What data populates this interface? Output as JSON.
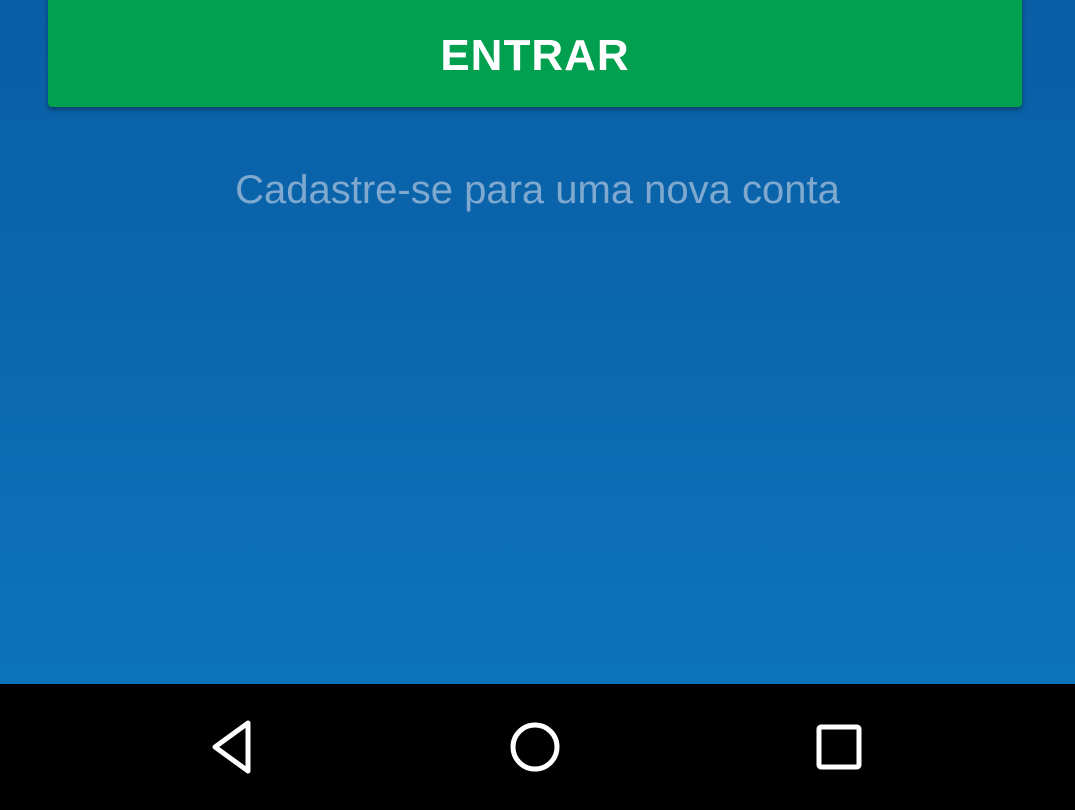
{
  "login": {
    "button_label": "ENTRAR",
    "button_color": "#00a04f"
  },
  "signup": {
    "link_text": "Cadastre-se para uma nova conta"
  },
  "background": {
    "top_color": "#0a5ea6",
    "bottom_color": "#0c74bb"
  },
  "navigation_bar": {
    "buttons": [
      {
        "icon": "back-triangle-icon"
      },
      {
        "icon": "home-circle-icon"
      },
      {
        "icon": "recents-square-icon"
      }
    ]
  }
}
